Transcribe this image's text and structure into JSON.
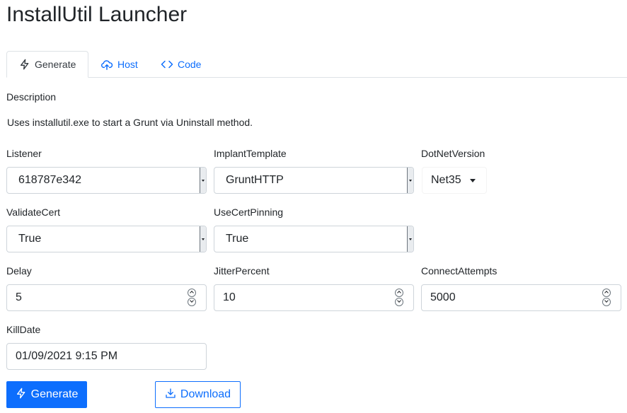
{
  "page": {
    "title": "InstallUtil Launcher"
  },
  "tabs": [
    {
      "label": "Generate",
      "icon": "lightning-icon",
      "active": true
    },
    {
      "label": "Host",
      "icon": "cloud-upload-icon",
      "active": false
    },
    {
      "label": "Code",
      "icon": "code-icon",
      "active": false
    }
  ],
  "description": {
    "label": "Description",
    "text": "Uses installutil.exe to start a Grunt via Uninstall method."
  },
  "fields": {
    "listener": {
      "label": "Listener",
      "value": "618787e342"
    },
    "implant_template": {
      "label": "ImplantTemplate",
      "value": "GruntHTTP"
    },
    "dotnet_version": {
      "label": "DotNetVersion",
      "value": "Net35"
    },
    "validate_cert": {
      "label": "ValidateCert",
      "value": "True"
    },
    "use_cert_pinning": {
      "label": "UseCertPinning",
      "value": "True"
    },
    "delay": {
      "label": "Delay",
      "value": "5"
    },
    "jitter_percent": {
      "label": "JitterPercent",
      "value": "10"
    },
    "connect_attempts": {
      "label": "ConnectAttempts",
      "value": "5000"
    },
    "kill_date": {
      "label": "KillDate",
      "value": "01/09/2021 9:15 PM"
    }
  },
  "buttons": {
    "generate": "Generate",
    "download": "Download"
  },
  "colors": {
    "accent": "#0d6efd",
    "text": "#212529",
    "border": "#ced4da"
  }
}
